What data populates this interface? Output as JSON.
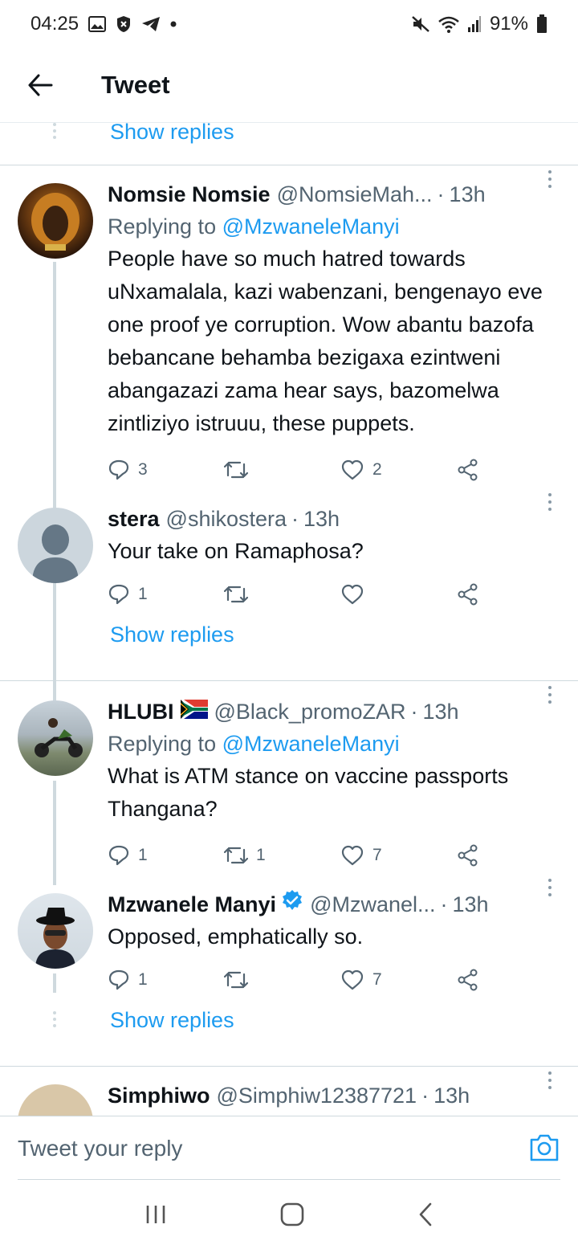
{
  "status_bar": {
    "time": "04:25",
    "battery": "91%",
    "icons_left": [
      "gallery-icon",
      "shield-icon",
      "telegram-icon",
      "dot-icon"
    ],
    "icons_right": [
      "mute-icon",
      "wifi-icon",
      "signal-icon",
      "battery-icon"
    ]
  },
  "header": {
    "title": "Tweet"
  },
  "feed": {
    "top_show_replies": "Show replies",
    "threads": [
      {
        "tweets": [
          {
            "name": "Nomsie Nomsie",
            "handle": "@NomsieMah...",
            "time": "13h",
            "replying_prefix": "Replying to",
            "replying_to": "@MzwaneleManyi",
            "text": "People have so much hatred towards uNxamalala, kazi wabenzani, bengenayo eve one proof ye corruption. Wow abantu bazofa bebancane behamba bezigaxa ezintweni abangazazi zama hear says, bazomelwa zintliziyo istruuu, these puppets.",
            "replies": "3",
            "retweets": "",
            "likes": "2"
          },
          {
            "name": "stera",
            "handle": "@shikostera",
            "time": "13h",
            "text": "Your take on Ramaphosa?",
            "replies": "1",
            "retweets": "",
            "likes": ""
          }
        ],
        "show_replies": "Show replies"
      },
      {
        "tweets": [
          {
            "name": "HLUBI",
            "handle": "@Black_promoZAR",
            "time": "13h",
            "replying_prefix": "Replying to",
            "replying_to": "@MzwaneleManyi",
            "text": "What is ATM stance on vaccine passports Thangana?",
            "replies": "1",
            "retweets": "1",
            "likes": "7"
          },
          {
            "name": "Mzwanele Manyi",
            "handle": "@Mzwanel...",
            "time": "13h",
            "text": "Opposed, emphatically so.",
            "replies": "1",
            "retweets": "",
            "likes": "7"
          }
        ],
        "show_replies": "Show replies"
      }
    ],
    "partial_next": {
      "name": "Simphiwo",
      "handle": "@Simphiw12387721",
      "time": "13h"
    }
  },
  "compose": {
    "placeholder": "Tweet your reply"
  },
  "colors": {
    "accent": "#1d9bf0",
    "text": "#0f1419",
    "muted": "#536471",
    "divider": "#cfd9de"
  }
}
